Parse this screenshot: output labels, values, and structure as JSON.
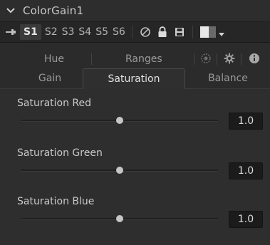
{
  "title": "ColorGain1",
  "toolbar": {
    "versions": [
      "S1",
      "S2",
      "S3",
      "S4",
      "S5",
      "S6"
    ],
    "active_version": "S1",
    "icons": [
      "pin-icon",
      "disable-icon",
      "lock-icon",
      "save-icon",
      "color-swatch",
      "dropdown-caret-icon"
    ]
  },
  "tabs_row1": [
    "Hue",
    "Ranges"
  ],
  "tabs_row2": [
    "Gain",
    "Saturation",
    "Balance"
  ],
  "active_tab": "Saturation",
  "controls": [
    {
      "label": "Saturation Red",
      "value": "1.0",
      "slider_position": 0.5
    },
    {
      "label": "Saturation Green",
      "value": "1.0",
      "slider_position": 0.5
    },
    {
      "label": "Saturation Blue",
      "value": "1.0",
      "slider_position": 0.5
    }
  ],
  "colors": {
    "background": "#2b2b2b",
    "text": "#c9c9c9",
    "field": "#1b1b1b"
  }
}
